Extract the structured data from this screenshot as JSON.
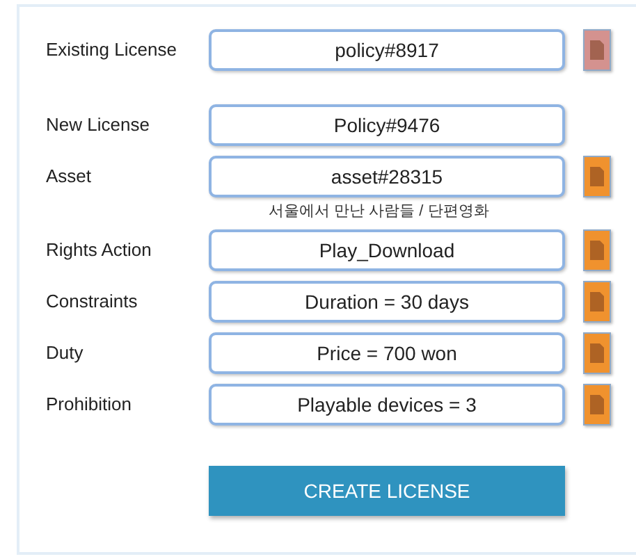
{
  "rows": [
    {
      "label": "Existing License",
      "value": "policy#8917",
      "file_button": {
        "color": "#d4928f"
      },
      "gap_after": true
    },
    {
      "label": "New License",
      "value": "Policy#9476"
    },
    {
      "label": "Asset",
      "value": "asset#28315",
      "file_button": {
        "color": "#f0922e"
      },
      "note": "서울에서 만난 사람들 / 단편영화"
    },
    {
      "label": "Rights Action",
      "value": "Play_Download",
      "file_button": {
        "color": "#f0922e"
      }
    },
    {
      "label": "Constraints",
      "value": "Duration = 30 days",
      "file_button": {
        "color": "#f0922e"
      }
    },
    {
      "label": "Duty",
      "value": "Price = 700 won",
      "file_button": {
        "color": "#f0922e"
      }
    },
    {
      "label": "Prohibition",
      "value": "Playable devices = 3",
      "file_button": {
        "color": "#f0922e"
      }
    }
  ],
  "submit": {
    "label": "CREATE LICENSE"
  }
}
